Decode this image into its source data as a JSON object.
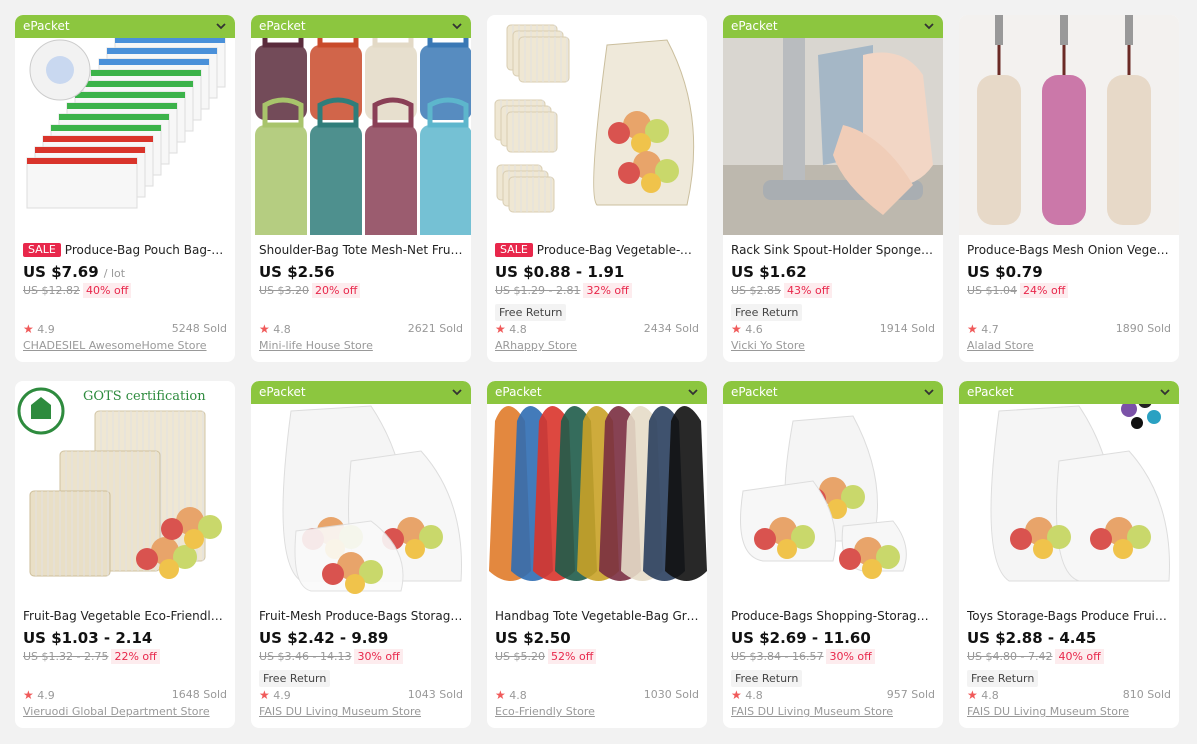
{
  "colors": {
    "epacket_green": "#8cc63f",
    "sale_red": "#e8274b",
    "page_bg": "#f2f2f2"
  },
  "products": [
    {
      "epacket": "ePacket",
      "sale": "SALE",
      "title": "Produce-Bag Pouch Bag-H...",
      "price": "US $7.69",
      "unit": "/ lot",
      "old": "US $12.82",
      "off": "40% off",
      "free": "",
      "rating": "4.9",
      "sold": "5248 Sold",
      "store": "CHADESIEL AwesomeHome Store",
      "image": "mesh-bags-colored-drawstrings"
    },
    {
      "epacket": "ePacket",
      "sale": "",
      "title": "Shoulder-Bag Tote Mesh-Net Fruit ...",
      "price": "US $2.56",
      "unit": "",
      "old": "US $3.20",
      "off": "20% off",
      "free": "",
      "rating": "4.8",
      "sold": "2621 Sold",
      "store": "Mini-life House Store",
      "image": "colorful-string-totes"
    },
    {
      "epacket": "",
      "sale": "SALE",
      "title": "Produce-Bag Vegetable-B...",
      "price": "US $0.88 - 1.91",
      "unit": "",
      "old": "US $1.29 - 2.81",
      "off": "32% off",
      "free": "Free Return",
      "rating": "4.8",
      "sold": "2434 Sold",
      "store": "ARhappy Store",
      "image": "cotton-mesh-bag-with-fruit"
    },
    {
      "epacket": "ePacket",
      "sale": "",
      "title": "Rack Sink Spout-Holder Sponge-St...",
      "price": "US $1.62",
      "unit": "",
      "old": "US $2.85",
      "off": "43% off",
      "free": "Free Return",
      "rating": "4.6",
      "sold": "1914 Sold",
      "store": "Vicki Yo Store",
      "image": "sink-faucet-sponge-holder"
    },
    {
      "epacket": "",
      "sale": "",
      "title": "Produce-Bags Mesh Onion Vegeta...",
      "price": "US $0.79",
      "unit": "",
      "old": "US $1.04",
      "off": "24% off",
      "free": "",
      "rating": "4.7",
      "sold": "1890 Sold",
      "store": "Alalad Store",
      "image": "hanging-mesh-onion-bags"
    },
    {
      "epacket": "",
      "sale": "",
      "title": "Fruit-Bag Vegetable Eco-Friendly O...",
      "price": "US $1.03 - 2.14",
      "unit": "",
      "old": "US $1.32 - 2.75",
      "off": "22% off",
      "free": "",
      "rating": "4.9",
      "sold": "1648 Sold",
      "store": "Vieruodi Global Department Store",
      "image": "gots-cotton-mesh-bags",
      "overlay_text": "GOTS certification"
    },
    {
      "epacket": "ePacket",
      "sale": "",
      "title": "Fruit-Mesh Produce-Bags Storage-...",
      "price": "US $2.42 - 9.89",
      "unit": "",
      "old": "US $3.46 - 14.13",
      "off": "30% off",
      "free": "Free Return",
      "rating": "4.9",
      "sold": "1043 Sold",
      "store": "FAIS DU Living Museum Store",
      "image": "white-mesh-produce-bags"
    },
    {
      "epacket": "ePacket",
      "sale": "",
      "title": "Handbag Tote Vegetable-Bag Groc...",
      "price": "US $2.50",
      "unit": "",
      "old": "US $5.20",
      "off": "52% off",
      "free": "",
      "rating": "4.8",
      "sold": "1030 Sold",
      "store": "Eco-Friendly Store",
      "image": "rainbow-net-totes"
    },
    {
      "epacket": "ePacket",
      "sale": "",
      "title": "Produce-Bags Shopping-Storage-T...",
      "price": "US $2.69 - 11.60",
      "unit": "",
      "old": "US $3.84 - 16.57",
      "off": "30% off",
      "free": "Free Return",
      "rating": "4.8",
      "sold": "957 Sold",
      "store": "FAIS DU Living Museum Store",
      "image": "white-mesh-produce-bags-small"
    },
    {
      "epacket": "ePacket",
      "sale": "",
      "title": "Toys Storage-Bags Produce Fruit Ki...",
      "price": "US $2.88 - 4.45",
      "unit": "",
      "old": "US $4.80 - 7.42",
      "off": "40% off",
      "free": "Free Return",
      "rating": "4.8",
      "sold": "810 Sold",
      "store": "FAIS DU Living Museum Store",
      "image": "white-mesh-bags-with-toys"
    }
  ]
}
